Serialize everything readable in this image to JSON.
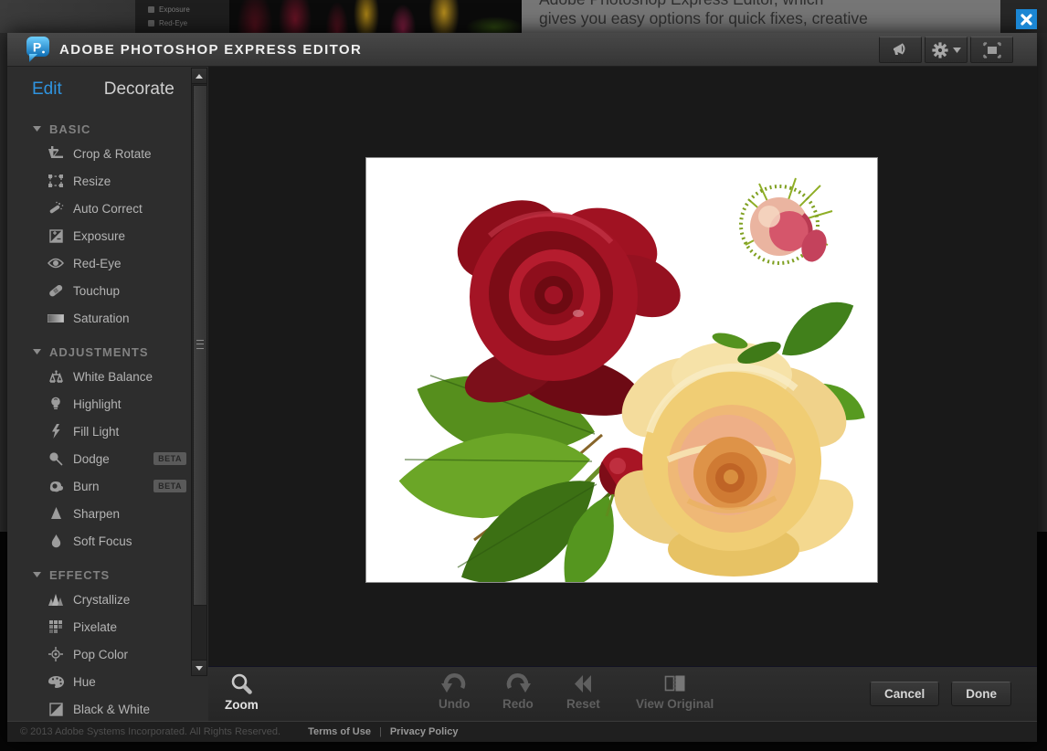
{
  "backdrop": {
    "mini_sidebar_items": [
      "Exposure",
      "Red-Eye"
    ],
    "paragraph_line1": "Adobe Photoshop Express Editor, which",
    "paragraph_line2": "gives you easy options for quick fixes, creative"
  },
  "header": {
    "title": "ADOBE PHOTOSHOP EXPRESS EDITOR"
  },
  "tabs": [
    {
      "label": "Edit"
    },
    {
      "label": "Decorate"
    }
  ],
  "sidebar": {
    "beta_label": "BETA",
    "sections": [
      {
        "title": "BASIC",
        "items": [
          {
            "label": "Crop & Rotate"
          },
          {
            "label": "Resize"
          },
          {
            "label": "Auto Correct"
          },
          {
            "label": "Exposure"
          },
          {
            "label": "Red-Eye"
          },
          {
            "label": "Touchup"
          },
          {
            "label": "Saturation"
          }
        ]
      },
      {
        "title": "ADJUSTMENTS",
        "items": [
          {
            "label": "White Balance"
          },
          {
            "label": "Highlight"
          },
          {
            "label": "Fill Light"
          },
          {
            "label": "Dodge",
            "beta": true
          },
          {
            "label": "Burn",
            "beta": true
          },
          {
            "label": "Sharpen"
          },
          {
            "label": "Soft Focus"
          }
        ]
      },
      {
        "title": "EFFECTS",
        "items": [
          {
            "label": "Crystallize"
          },
          {
            "label": "Pixelate"
          },
          {
            "label": "Pop Color"
          },
          {
            "label": "Hue"
          },
          {
            "label": "Black & White"
          }
        ]
      }
    ]
  },
  "toolbar": {
    "zoom": "Zoom",
    "undo": "Undo",
    "redo": "Redo",
    "reset": "Reset",
    "view_original": "View Original",
    "cancel": "Cancel",
    "done": "Done"
  },
  "footer": {
    "copyright": "© 2013 Adobe Systems Incorporated. All Rights Reserved.",
    "terms": "Terms of Use",
    "separator": "|",
    "privacy": "Privacy Policy"
  },
  "icons": {
    "close": "✕",
    "gear": "gear",
    "megaphone": "megaphone",
    "fullscreen": "fullscreen",
    "caret": "▾",
    "scroll_up": "▴",
    "scroll_down": "▾"
  },
  "colors": {
    "accent_blue": "#2f94e0",
    "close_blue": "#1b86d3",
    "canvas_bg": "#191919"
  }
}
